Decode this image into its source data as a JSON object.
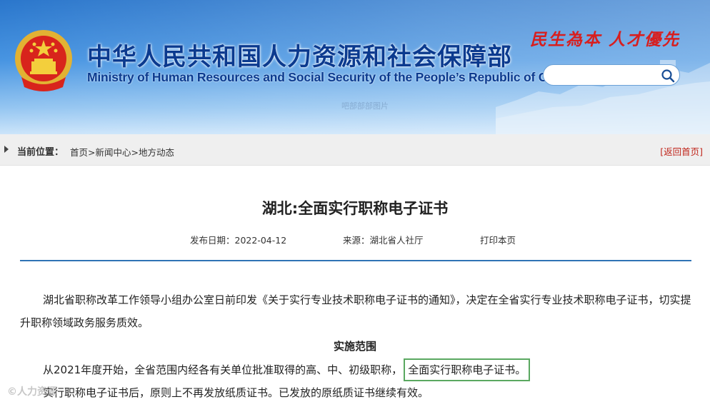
{
  "header": {
    "title_cn": "中华人民共和国人力资源和社会保障部",
    "title_en": "Ministry of Human Resources and Social Security of the People’s Republic of China",
    "slogan": "民生為本 人才優先",
    "search": {
      "value": "",
      "placeholder": ""
    },
    "watermark": "吧部部部图片"
  },
  "breadcrumb": {
    "label": "当前位置：",
    "items": [
      "首页",
      "新闻中心",
      "地方动态"
    ],
    "separator": ">",
    "back_home": "[返回首页]"
  },
  "article": {
    "title": "湖北:全面实行职称电子证书",
    "date_label": "发布日期：",
    "date": "2022-04-12",
    "source_label": "来源：",
    "source": "湖北省人社厅",
    "print": "打印本页",
    "para1": "湖北省职称改革工作领导小组办公室日前印发《关于实行专业技术职称电子证书的通知》，决定在全省实行专业技术职称电子证书，切实提升职称领域政务服务质效。",
    "section_heading": "实施范围",
    "para2_before": "从2021年度开始，全省范围内经各有关单位批准取得的高、中、初级职称，",
    "para2_highlight": "全面实行职称电子证书。",
    "para3": "实行职称电子证书后，原则上不再发放纸质证书。已发放的原纸质证书继续有效。"
  },
  "corner_watermark": "©人力资源"
}
